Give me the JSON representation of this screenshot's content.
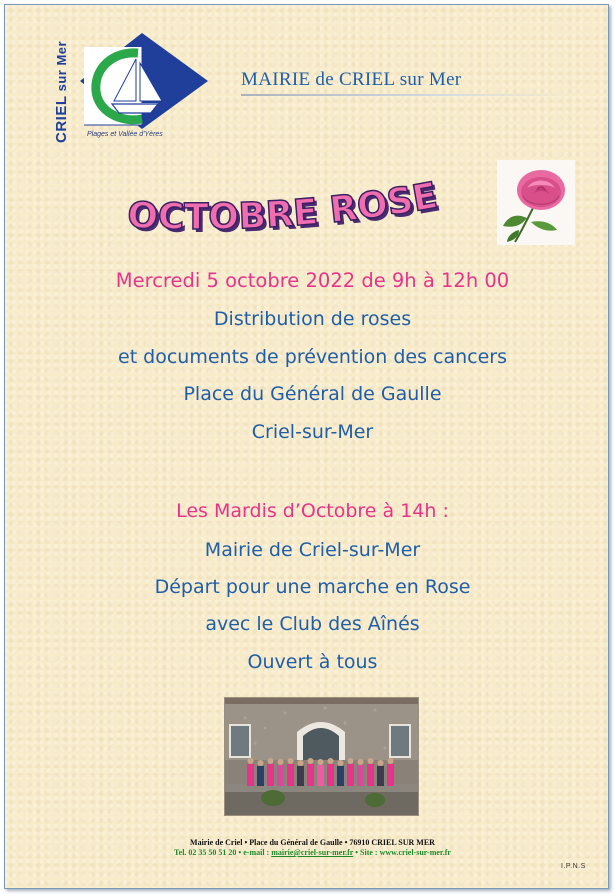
{
  "header": {
    "logo_text_bold": "CRIEL",
    "logo_text_rest": " sur Mer",
    "logo_caption": "Plages et Vallée d'Yères",
    "mairie_title": "MAIRIE de CRIEL sur Mer"
  },
  "title": "OCTOBRE ROSE",
  "event1": {
    "date_line": "Mercredi 5 octobre 2022 de 9h à 12h 00",
    "lines": [
      "Distribution de roses",
      "et documents de prévention des cancers",
      "Place du Général de Gaulle",
      "Criel-sur-Mer"
    ]
  },
  "event2": {
    "heading": "Les Mardis d’Octobre à 14h :",
    "lines": [
      "Mairie de Criel-sur-Mer",
      "Départ pour une marche en Rose",
      "avec le Club des Aînés",
      "Ouvert à tous"
    ]
  },
  "footer": {
    "address": "Mairie de Criel • Place du Général de Gaulle • 76910 CRIEL SUR MER",
    "tel_prefix": "Tel. 02 35 50 51 20 • e-mail : ",
    "email": "mairie@criel-sur-mer.fr",
    "site_part": " • Site : www.criel-sur-mer.fr",
    "ipns": "I.P.N.S"
  },
  "colors": {
    "background": "#f7ebca",
    "pink": "#e8338a",
    "blue": "#1f5ea8",
    "footer_green": "#1d8a2a"
  }
}
